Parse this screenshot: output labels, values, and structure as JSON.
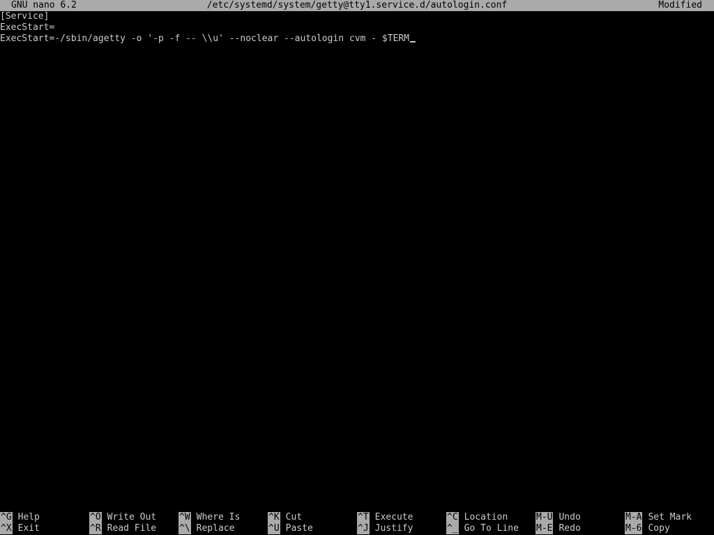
{
  "titlebar": {
    "app": "GNU nano 6.2",
    "file": "/etc/systemd/system/getty@tty1.service.d/autologin.conf",
    "status": "Modified"
  },
  "buffer": {
    "lines": [
      "[Service]",
      "ExecStart=",
      "ExecStart=-/sbin/agetty -o '-p -f -- \\\\u' --noclear --autologin cvm - $TERM"
    ]
  },
  "shortcuts": {
    "top": [
      {
        "key": "^G",
        "label": "Help"
      },
      {
        "key": "^O",
        "label": "Write Out"
      },
      {
        "key": "^W",
        "label": "Where Is"
      },
      {
        "key": "^K",
        "label": "Cut"
      },
      {
        "key": "^T",
        "label": "Execute"
      },
      {
        "key": "^C",
        "label": "Location"
      },
      {
        "key": "M-U",
        "label": "Undo"
      },
      {
        "key": "M-A",
        "label": "Set Mark"
      }
    ],
    "bottom": [
      {
        "key": "^X",
        "label": "Exit"
      },
      {
        "key": "^R",
        "label": "Read File"
      },
      {
        "key": "^\\",
        "label": "Replace"
      },
      {
        "key": "^U",
        "label": "Paste"
      },
      {
        "key": "^J",
        "label": "Justify"
      },
      {
        "key": "^_",
        "label": "Go To Line"
      },
      {
        "key": "M-E",
        "label": "Redo"
      },
      {
        "key": "M-6",
        "label": "Copy"
      }
    ]
  },
  "colors": {
    "background": "#000000",
    "text": "#cccccc",
    "bar": "#aaaaaa"
  }
}
